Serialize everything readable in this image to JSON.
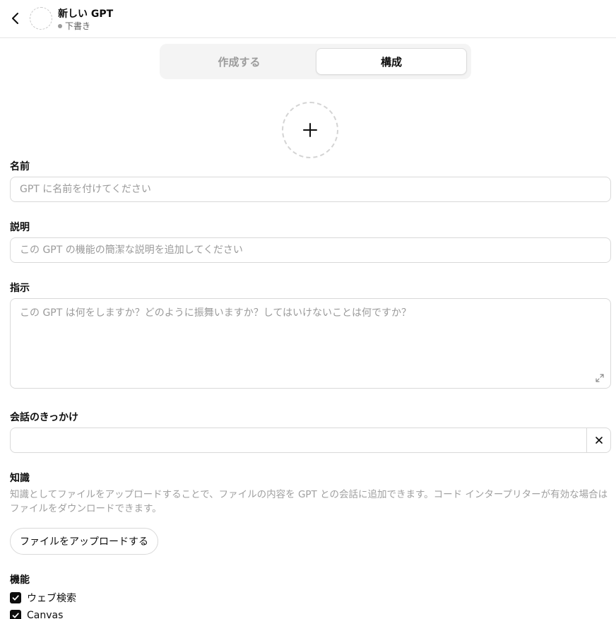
{
  "header": {
    "back_icon": "chevron-left-icon",
    "gpt_name": "新しい GPT",
    "status": "下書き"
  },
  "tabs": [
    {
      "label": "作成する",
      "active": false
    },
    {
      "label": "構成",
      "active": true
    }
  ],
  "avatar_upload": {
    "icon": "plus-icon"
  },
  "form": {
    "name": {
      "label": "名前",
      "placeholder": "GPT に名前を付けてください",
      "value": ""
    },
    "description": {
      "label": "説明",
      "placeholder": "この GPT の機能の簡潔な説明を追加してください",
      "value": ""
    },
    "instructions": {
      "label": "指示",
      "placeholder": "この GPT は何をしますか？どのように振舞いますか？してはいけないことは何ですか？",
      "value": "",
      "expand_icon": "expand-icon"
    },
    "conversation_starters": {
      "label": "会話のきっかけ",
      "value": "",
      "clear_icon": "close-icon"
    },
    "knowledge": {
      "label": "知識",
      "description": "知識としてファイルをアップロードすることで、ファイルの内容を GPT との会話に追加できます。コード インタープリターが有効な場合はファイルをダウンロードできます。",
      "upload_button": "ファイルをアップロードする"
    },
    "capabilities": {
      "label": "機能",
      "items": [
        {
          "label": "ウェブ検索",
          "checked": true
        },
        {
          "label": "Canvas",
          "checked": true
        }
      ]
    }
  }
}
